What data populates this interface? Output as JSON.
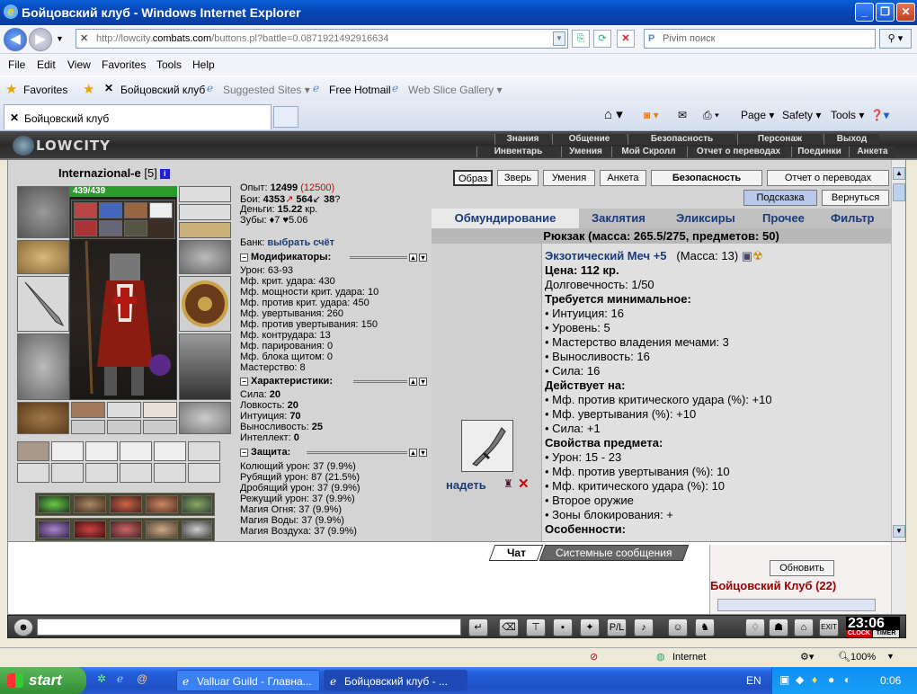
{
  "window": {
    "title": "Бойцовский клуб - Windows Internet Explorer"
  },
  "address": {
    "url_prefix": "http://lowcity.",
    "url_domain": "combats.com",
    "url_rest": "/buttons.pl?battle=0.0871921492916634",
    "search_placeholder": "Pivim поиск"
  },
  "menu": [
    "File",
    "Edit",
    "View",
    "Favorites",
    "Tools",
    "Help"
  ],
  "favorites": {
    "label": "Favorites",
    "items": [
      "Бойцовский клуб",
      "Suggested Sites ▾",
      "Free Hotmail",
      "Web Slice Gallery ▾"
    ]
  },
  "tab": {
    "title": "Бойцовский клуб"
  },
  "commands": {
    "page": "Page ▾",
    "safety": "Safety ▾",
    "tools": "Tools ▾"
  },
  "game": {
    "logo": "LOWCITY",
    "nav_top": [
      "Знания",
      "Общение",
      "Безопасность",
      "Персонаж",
      "Выход"
    ],
    "nav_bottom": [
      "Инвентарь",
      "Умения",
      "Мой Скролл",
      "Отчет о переводах",
      "Поединки",
      "Анкета"
    ]
  },
  "character": {
    "name": "Internazional-e",
    "level": "[5]",
    "hp": "439/439",
    "exp_label": "Опыт:",
    "exp": "12499",
    "exp_next": "(12500)",
    "fights_label": "Бои:",
    "wins": "4353",
    "losses": "564",
    "draws": "38",
    "money_label": "Деньги:",
    "money": "15.22",
    "money_unit": "кр.",
    "teeth_label": "Зубы:",
    "teeth": "7",
    "teeth2": "5.06",
    "bank_label": "Банк:",
    "bank_link": "выбрать счёт"
  },
  "modifiers": {
    "title": "Модификаторы:",
    "rows": [
      "Урон: 63-93",
      "Мф. крит. удара: 430",
      "Мф. мощности крит. удара: 10",
      "Мф. против крит. удара: 450",
      "Мф. увертывания: 260",
      "Мф. против увертывания: 150",
      "Мф. контрудара: 13",
      "Мф. парирования: 0",
      "Мф. блока щитом: 0",
      "Мастерство: 8"
    ]
  },
  "stats": {
    "title": "Характеристики:",
    "rows": [
      {
        "k": "Сила:",
        "v": "20"
      },
      {
        "k": "Ловкость:",
        "v": "20"
      },
      {
        "k": "Интуиция:",
        "v": "70"
      },
      {
        "k": "Выносливость:",
        "v": "25"
      },
      {
        "k": "Интеллект:",
        "v": "0"
      }
    ]
  },
  "defense": {
    "title": "Защита:",
    "rows": [
      "Колющий урон: 37 (9.9%)",
      "Рубящий урон: 87 (21.5%)",
      "Дробящий урон: 37 (9.9%)",
      "Режущий урон: 37 (9.9%)",
      "Магия Огня: 37 (9.9%)",
      "Магия Воды: 37 (9.9%)",
      "Магия Воздуха: 37 (9.9%)"
    ]
  },
  "top_buttons": [
    "Образ",
    "Зверь",
    "Умения",
    "Анкета",
    "Безопасность",
    "Отчет о переводах"
  ],
  "sub_buttons": [
    "Подсказка",
    "Вернуться"
  ],
  "inventory_tabs": [
    "Обмундирование",
    "Заклятия",
    "Эликсиры",
    "Прочее",
    "Фильтр"
  ],
  "backpack": "Рюкзак (масса: 265.5/275, предметов: 50)",
  "item": {
    "name": "Экзотический Меч +5",
    "mass": "(Масса: 13)",
    "price": "Цена: 112 кр.",
    "durability": "Долговечность: 1/50",
    "req_title": "Требуется минимальное:",
    "req": [
      "• Интуиция: 16",
      "• Уровень: 5",
      "• Мастерство владения мечами: 3",
      "• Выносливость: 16",
      "• Сила: 16"
    ],
    "acts_title": "Действует на:",
    "acts": [
      "• Мф. против критического удара (%): +10",
      "• Мф. увертывания (%): +10",
      "• Сила: +1"
    ],
    "props_title": "Свойства предмета:",
    "props": [
      "• Урон: 15 - 23",
      "• Мф. против увертывания (%): 10",
      "• Мф. критического удара (%): 10",
      "• Второе оружие",
      "• Зоны блокирования: +"
    ],
    "special_title": "Особенности:",
    "equip": "надеть"
  },
  "chat": {
    "tab_chat": "Чат",
    "tab_system": "Системные сообщения",
    "refresh": "Обновить",
    "club": "Бойцовский Клуб (22)"
  },
  "clock": {
    "time": "23:06",
    "labels": [
      "CLOCK",
      "TIMER"
    ]
  },
  "status": {
    "zone": "Internet",
    "zoom": "100%"
  },
  "taskbar": {
    "start": "start",
    "tasks": [
      "Valluar Guild - Главна...",
      "Бойцовский клуб - ..."
    ],
    "lang": "EN",
    "time": "0:06"
  },
  "colors": {
    "accent": "#1a3a7a",
    "hp": "#2a9a2a",
    "red": "#cc0000",
    "xp_red": "#cc0000"
  }
}
